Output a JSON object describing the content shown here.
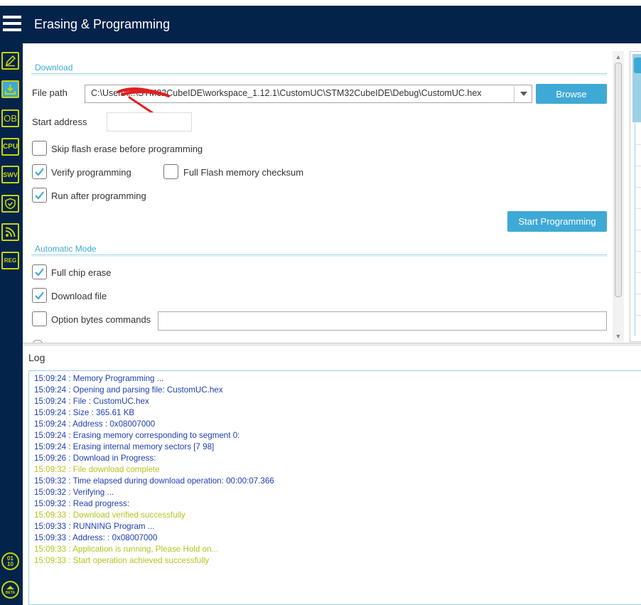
{
  "header": {
    "title": "Erasing & Programming"
  },
  "sidebar": {
    "items": [
      {
        "name": "edit",
        "label": ""
      },
      {
        "name": "download",
        "label": ""
      },
      {
        "name": "ob",
        "label": "OB"
      },
      {
        "name": "cpu",
        "label": "CPU"
      },
      {
        "name": "swv",
        "label": "SWV"
      },
      {
        "name": "security",
        "label": ""
      },
      {
        "name": "rss",
        "label": ""
      },
      {
        "name": "reg",
        "label": "REG"
      }
    ],
    "bottom": [
      {
        "name": "binary",
        "label": "01\n10"
      },
      {
        "name": "beta",
        "label": "BETA"
      }
    ]
  },
  "download": {
    "section_title": "Download",
    "file_path_label": "File path",
    "file_path_value": "C:\\Users\\...\\STM32CubeIDE\\workspace_1.12.1\\CustomUC\\STM32CubeIDE\\Debug\\CustomUC.hex",
    "browse_label": "Browse",
    "start_address_label": "Start address",
    "start_address_value": "",
    "skip_erase_label": "Skip flash erase before programming",
    "skip_erase_checked": false,
    "verify_label": "Verify programming",
    "verify_checked": true,
    "full_checksum_label": "Full Flash memory checksum",
    "full_checksum_checked": false,
    "run_after_label": "Run after programming",
    "run_after_checked": true,
    "start_programming_label": "Start Programming"
  },
  "automatic": {
    "section_title": "Automatic Mode",
    "full_chip_erase_label": "Full chip erase",
    "full_chip_erase_checked": true,
    "download_file_label": "Download file",
    "download_file_checked": true,
    "option_bytes_label": "Option bytes commands",
    "option_bytes_checked": false,
    "option_bytes_value": ""
  },
  "log": {
    "title": "Log",
    "lines": [
      {
        "text": "15:09:24 : Memory Programming ...",
        "type": "info"
      },
      {
        "text": "15:09:24 : Opening and parsing file: CustomUC.hex",
        "type": "info"
      },
      {
        "text": "15:09:24 :   File          : CustomUC.hex",
        "type": "info"
      },
      {
        "text": "15:09:24 :   Size          : 365.61 KB",
        "type": "info"
      },
      {
        "text": "15:09:24 :   Address       : 0x08007000",
        "type": "info"
      },
      {
        "text": "15:09:24 : Erasing memory corresponding to segment 0:",
        "type": "info"
      },
      {
        "text": "15:09:24 : Erasing internal memory sectors [7 98]",
        "type": "info"
      },
      {
        "text": "15:09:26 : Download in Progress:",
        "type": "info"
      },
      {
        "text": "15:09:32 : File download complete",
        "type": "ok"
      },
      {
        "text": "15:09:32 : Time elapsed during download operation: 00:00:07.366",
        "type": "info"
      },
      {
        "text": "15:09:32 : Verifying ...",
        "type": "info"
      },
      {
        "text": "15:09:32 : Read progress:",
        "type": "info"
      },
      {
        "text": "15:09:33 : Download verified successfully",
        "type": "ok"
      },
      {
        "text": "15:09:33 : RUNNING Program ...",
        "type": "info"
      },
      {
        "text": "15:09:33 :   Address:      : 0x08007000",
        "type": "info"
      },
      {
        "text": "15:09:33 : Application is running, Please Hold on...",
        "type": "ok"
      },
      {
        "text": "15:09:33 : Start operation achieved successfully",
        "type": "ok"
      }
    ]
  },
  "colors": {
    "header_bg": "#03234b",
    "accent": "#3fa9d6",
    "icon_yellow": "#c8d400",
    "log_info": "#1f3fb3",
    "log_success": "#b4c41e"
  }
}
